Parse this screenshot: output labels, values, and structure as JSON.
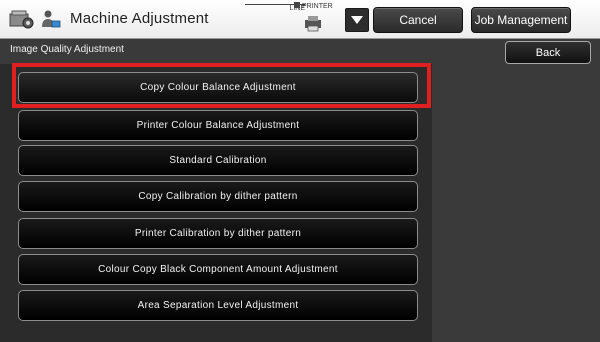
{
  "header": {
    "title": "Machine Adjustment",
    "line_label": "LINE",
    "printer_label": "PRINTER",
    "cancel_label": "Cancel",
    "job_management_label": "Job Management"
  },
  "subheader": {
    "title": "Image Quality Adjustment",
    "back_label": "Back"
  },
  "menu": {
    "items": [
      {
        "label": "Copy Colour Balance Adjustment",
        "selected": true
      },
      {
        "label": "Printer Colour Balance Adjustment"
      },
      {
        "label": "Standard Calibration"
      },
      {
        "label": "Copy Calibration by dither pattern"
      },
      {
        "label": "Printer Calibration by dither pattern"
      },
      {
        "label": "Colour Copy Black Component Amount Adjustment"
      },
      {
        "label": "Area Separation Level Adjustment"
      }
    ]
  },
  "colors": {
    "highlight": "#e02020",
    "background": "#3a3a3a",
    "button": "#000000"
  },
  "icons": [
    "machine-settings-icon",
    "person-icon",
    "printer-icon",
    "triangle-down-icon"
  ]
}
